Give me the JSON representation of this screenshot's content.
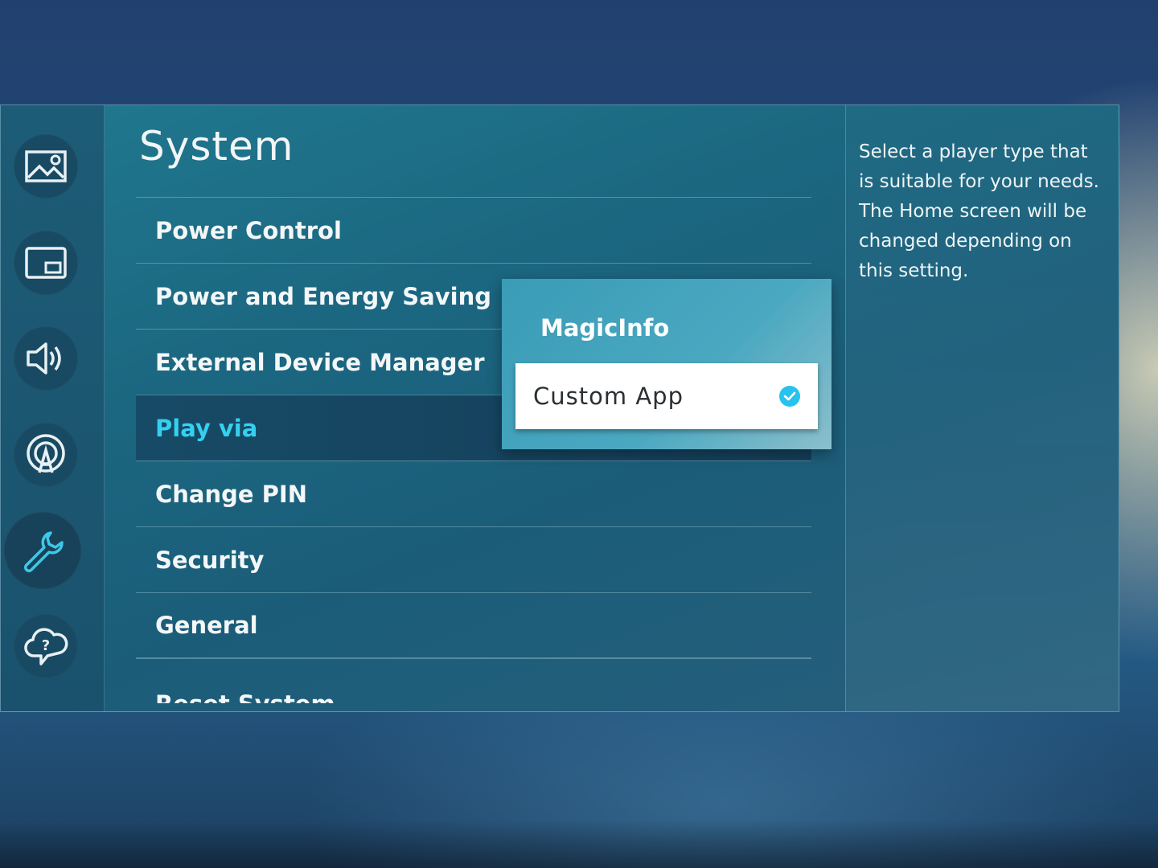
{
  "rail": {
    "items": [
      {
        "icon": "picture-icon"
      },
      {
        "icon": "picture-in-picture-icon"
      },
      {
        "icon": "sound-icon"
      },
      {
        "icon": "broadcast-icon"
      },
      {
        "icon": "wrench-icon",
        "active": true
      },
      {
        "icon": "support-cloud-icon"
      }
    ]
  },
  "main": {
    "title": "System",
    "items": [
      {
        "label": "Power Control"
      },
      {
        "label": "Power and Energy Saving"
      },
      {
        "label": "External Device Manager"
      },
      {
        "label": "Play via",
        "selected": true
      },
      {
        "label": "Change PIN"
      },
      {
        "label": "Security"
      },
      {
        "label": "General"
      },
      {
        "label": "Reset System"
      }
    ]
  },
  "dropdown": {
    "options": [
      "MagicInfo",
      "Custom App"
    ],
    "selected": "Custom App"
  },
  "description": "Select a player type that is suitable for your needs. The Home screen will be changed depending on this setting.",
  "colors": {
    "accent": "#35d0f0",
    "check": "#27c3ee"
  }
}
